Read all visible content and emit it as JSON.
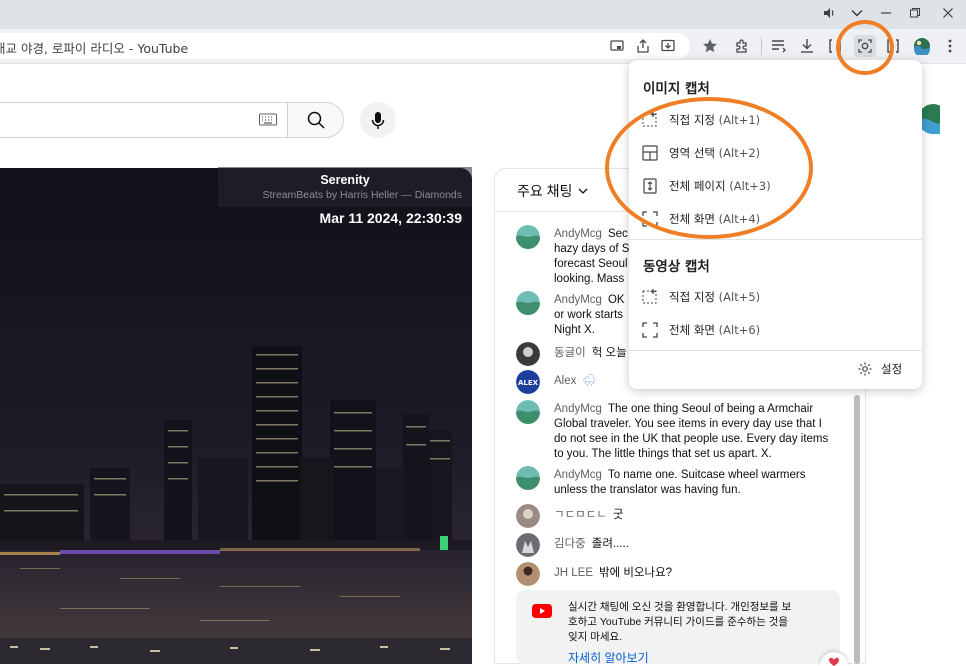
{
  "window": {
    "tab_title": "대교 야경, 로파이 라디오 - YouTube"
  },
  "youtube": {
    "search_placeholder": ""
  },
  "video": {
    "song_title": "Serenity",
    "song_artist": "StreamBeats by Harris Heller — Diamonds",
    "timestamp": "Mar 11 2024, 22:30:39"
  },
  "chat": {
    "header_label": "주요 채팅",
    "messages": [
      {
        "author": "AndyMcg",
        "text": "Sec hazy days of S forecast Seoul looking. Mass",
        "lines": [
          "Sec",
          "hazy days of S",
          "forecast Seoul",
          "looking. Mass"
        ]
      },
      {
        "author": "AndyMcg",
        "text": "OK or work starts Night X.",
        "lines": [
          "OK",
          "or work starts",
          "Night X."
        ]
      },
      {
        "author": "동글이",
        "text": "헉 오늘"
      },
      {
        "author": "Alex",
        "text": "🌧"
      },
      {
        "author": "AndyMcg",
        "text": "The one thing Seoul of being a Armchair Global traveler. You see items in every day use that I do not see in the UK that people use. Every day items to you. The little things that set us apart. X.",
        "lines": [
          "The one thing Seoul of being a Armchair",
          "Global traveler. You see items in every day use that I",
          "do not see in the UK that people use. Every day items",
          "to you. The little things that set us apart. X."
        ]
      },
      {
        "author": "AndyMcg",
        "text": "To name one. Suitcase wheel warmers unless the translator was having fun.",
        "lines": [
          "To name one. Suitcase wheel warmers",
          "unless the translator was having fun."
        ]
      },
      {
        "author": "ㄱㄷㅁㄷㄴ",
        "text": "굿"
      },
      {
        "author": "김다중",
        "text": "졸려....."
      },
      {
        "author": "JH LEE",
        "text": "밖에 비오나요?"
      }
    ],
    "welcome_text": "실시간 채팅에 오신 것을 환영합니다. 개인정보를 보호하고 YouTube 커뮤니티 가이드를 준수하는 것을 잊지 마세요.",
    "welcome_lines": [
      "실시간 채팅에 오신 것을 환영합니다. 개인정보를 보",
      "호하고 YouTube 커뮤니티 가이드를 준수하는 것을",
      "잊지 마세요."
    ],
    "learn_more": "자세히 알아보기"
  },
  "capture_menu": {
    "image_section": "이미지 캡처",
    "image_items": [
      {
        "label": "직접 지정",
        "shortcut": "(Alt+1)",
        "icon": "custom-area-icon"
      },
      {
        "label": "영역 선택",
        "shortcut": "(Alt+2)",
        "icon": "region-select-icon"
      },
      {
        "label": "전체 페이지",
        "shortcut": "(Alt+3)",
        "icon": "full-page-icon"
      },
      {
        "label": "전체 화면",
        "shortcut": "(Alt+4)",
        "icon": "full-screen-icon"
      }
    ],
    "video_section": "동영상 캡처",
    "video_items": [
      {
        "label": "직접 지정",
        "shortcut": "(Alt+5)",
        "icon": "custom-area-icon"
      },
      {
        "label": "전체 화면",
        "shortcut": "(Alt+6)",
        "icon": "full-screen-icon"
      }
    ],
    "settings_label": "설정"
  },
  "colors": {
    "annotation": "#f07e26",
    "youtube_red": "#ff0000"
  }
}
